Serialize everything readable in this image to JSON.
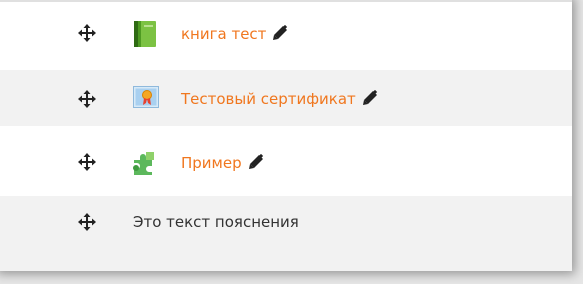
{
  "colors": {
    "link": "#f0771f",
    "text": "#333333",
    "alt_row": "#f2f2f2",
    "book_icon": "#7cc243",
    "certificate_icon": "#a9d0f0",
    "puzzle_icon": "#5cb85c"
  },
  "activities": [
    {
      "label": "книга тест",
      "icon": "book-icon",
      "editable": true
    },
    {
      "label": "Тестовый сертификат",
      "icon": "certificate-icon",
      "editable": true
    },
    {
      "label": "Пример",
      "icon": "puzzle-icon",
      "editable": true
    }
  ],
  "label_item": {
    "text": "Это текст пояснения"
  }
}
